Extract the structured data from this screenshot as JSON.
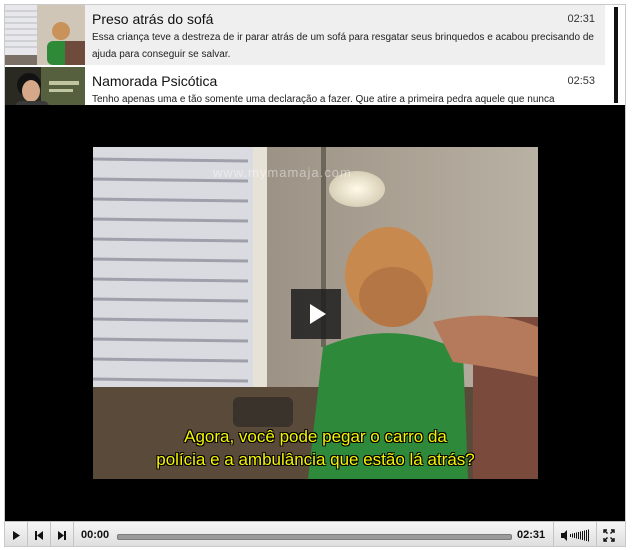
{
  "playlist": {
    "items": [
      {
        "title": "Preso atrás do sofá",
        "duration": "02:31",
        "description": "Essa criança teve a destreza de ir parar atrás de um sofá para resgatar seus brinquedos e acabou precisando de ajuda para conseguir se salvar."
      },
      {
        "title": "Namorada Psicótica",
        "duration": "02:53",
        "description": "Tenho apenas uma e tão somente uma declaração a fazer. Que atire a primeira pedra aquele que nunca"
      }
    ]
  },
  "video": {
    "watermark": "www.mymamaja.com",
    "subtitle_line1": "Agora, você pode pegar o carro da",
    "subtitle_line2": "polícia e a ambulância que estão lá atrás?"
  },
  "controls": {
    "current_time": "00:00",
    "total_time": "02:31",
    "progress": 0
  },
  "icons": {
    "play": "play-icon",
    "previous": "skip-back-icon",
    "next": "skip-forward-icon",
    "volume": "volume-icon",
    "fullscreen": "fullscreen-icon",
    "overlay_play": "play-overlay-icon"
  }
}
